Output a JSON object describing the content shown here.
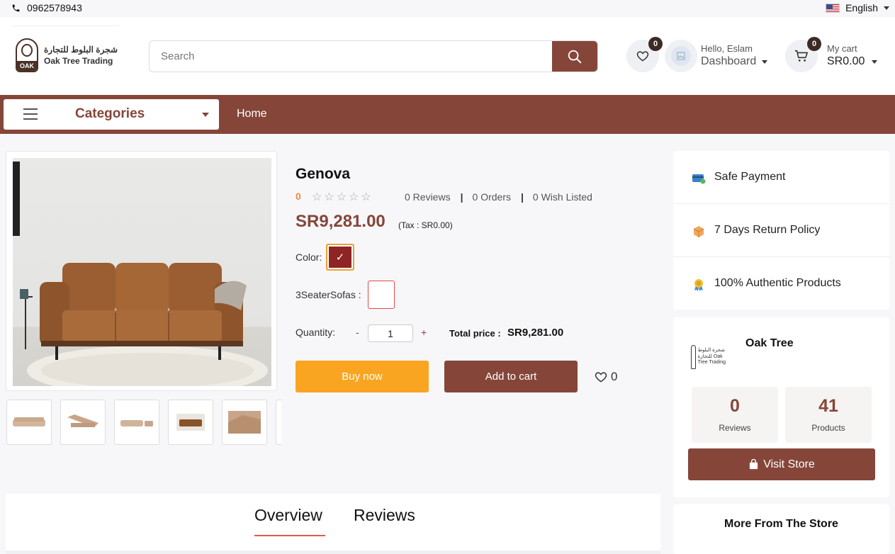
{
  "topbar": {
    "phone": "0962578943",
    "language": "English"
  },
  "header": {
    "logo_ar": "شجرة البلوط للتجارة",
    "logo_en": "Oak Tree Trading",
    "logo_mark": "OAK",
    "search_placeholder": "Search",
    "wishlist_count": "0",
    "greeting": "Hello, Eslam",
    "dashboard_label": "Dashboard",
    "cart_count": "0",
    "cart_label": "My cart",
    "cart_total": "SR0.00"
  },
  "nav": {
    "categories_label": "Categories",
    "home_label": "Home"
  },
  "product": {
    "name": "Genova",
    "rating": "0",
    "stars": "☆☆☆☆☆",
    "reviews": "0 Reviews",
    "orders": "0 Orders",
    "wish_listed": "0 Wish Listed",
    "price": "SR9,281.00",
    "tax": "(Tax : SR0.00)",
    "color_label": "Color:",
    "selected_color": "#8e2424",
    "color_check": "✓",
    "variant_label": "3SeaterSofas :",
    "quantity_label": "Quantity:",
    "minus": "-",
    "quantity": "1",
    "plus": "+",
    "total_label": "Total price :",
    "total_value": "SR9,281.00",
    "buy_now": "Buy now",
    "add_to_cart": "Add to cart",
    "wish_count": "0"
  },
  "features": [
    {
      "icon": "credit-card-icon",
      "label": "Safe Payment"
    },
    {
      "icon": "return-box-icon",
      "label": "7 Days Return Policy"
    },
    {
      "icon": "medal-icon",
      "label": "100% Authentic Products"
    }
  ],
  "store": {
    "name": "Oak Tree",
    "logo_text": "شجرة البلوط للتجارة Oak Tree Trading",
    "reviews_count": "0",
    "reviews_label": "Reviews",
    "products_count": "41",
    "products_label": "Products",
    "visit_label": "Visit Store",
    "more_label": "More From The Store"
  },
  "tabs": {
    "overview": "Overview",
    "reviews": "Reviews"
  },
  "colors": {
    "brand": "#854639",
    "accent": "#faa522",
    "dark_badge": "#3d2a25"
  }
}
